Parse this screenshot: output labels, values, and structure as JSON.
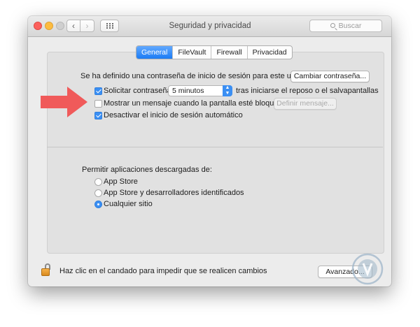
{
  "window": {
    "title": "Seguridad y privacidad"
  },
  "toolbar": {
    "back_glyph": "‹",
    "forward_glyph": "›",
    "grid_icon": "grid-icon",
    "search_placeholder": "Buscar"
  },
  "tabs": [
    {
      "label": "General",
      "selected": true
    },
    {
      "label": "FileVault",
      "selected": false
    },
    {
      "label": "Firewall",
      "selected": false
    },
    {
      "label": "Privacidad",
      "selected": false
    }
  ],
  "general": {
    "password_set_text": "Se ha definido una contraseña de inicio de sesión para este usuario",
    "change_password_button": "Cambiar contraseña...",
    "require_password": {
      "label": "Solicitar contraseña",
      "checked": true,
      "delay_value": "5 minutos",
      "suffix": "tras iniciarse el reposo o el salvapantallas"
    },
    "show_message": {
      "label": "Mostrar un mensaje cuando la pantalla esté bloqueada",
      "checked": false,
      "button": "Definir mensaje..."
    },
    "disable_autologin": {
      "label": "Desactivar el inicio de sesión automático",
      "checked": true
    },
    "apps_heading": "Permitir aplicaciones descargadas de:",
    "apps_options": [
      {
        "label": "App Store",
        "selected": false
      },
      {
        "label": "App Store y desarrolladores identificados",
        "selected": false
      },
      {
        "label": "Cualquier sitio",
        "selected": true
      }
    ]
  },
  "footer": {
    "lock_text": "Haz clic en el candado para impedir que se realicen cambios",
    "advanced_button": "Avanzado..."
  },
  "colors": {
    "accent": "#3b8ff3",
    "annotation_arrow": "#f05a5a",
    "lock": "#e79d2e"
  },
  "icons": {
    "lock": "lock-icon",
    "annotation": "red-arrow-icon",
    "watermark": "watermark-logo-icon"
  }
}
